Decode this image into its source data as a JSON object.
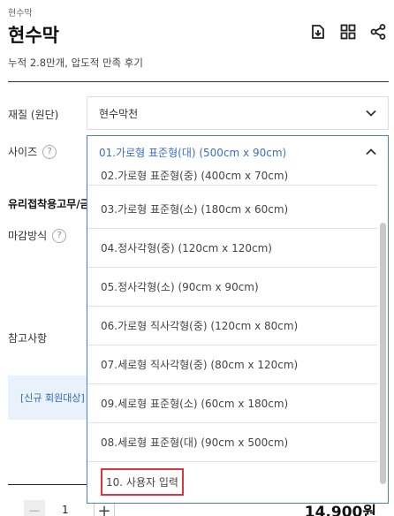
{
  "breadcrumb": "현수막",
  "title": "현수막",
  "subtitle": "누적 2.8만개, 압도적 만족 후기",
  "header_icons": [
    "download-icon",
    "grid-icon",
    "share-icon"
  ],
  "fields": {
    "material_label": "재질 (원단)",
    "material_value": "현수막천",
    "size_label": "사이즈",
    "size_value": "01.가로형 표준형(대) (500cm x 90cm)",
    "glass_label": "유리접착용고무/금",
    "finish_label": "마감방식",
    "notes_label": "참고사항",
    "help_glyph": "?"
  },
  "banner_text": "[신규 회원대상]",
  "dropdown": {
    "items": [
      "02.가로형 표준형(중) (400cm x 70cm)",
      "03.가로형 표준형(소) (180cm x 60cm)",
      "04.정사각형(중) (120cm x 120cm)",
      "05.정사각형(소) (90cm x 90cm)",
      "06.가로형 직사각형(중) (120cm x 80cm)",
      "07.세로형 직사각형(중) (80cm x 120cm)",
      "09.세로형 표준형(소) (60cm x 180cm)",
      "08.세로형 표준형(대) (90cm x 500cm)",
      "10. 사용자 입력"
    ]
  },
  "footer": {
    "minus": "−",
    "quantity": "1",
    "plus": "+",
    "price": "14,900원"
  },
  "colors": {
    "accent": "#4a7fd1",
    "highlight": "#d9363e",
    "banner_bg": "#e9f2fb"
  }
}
